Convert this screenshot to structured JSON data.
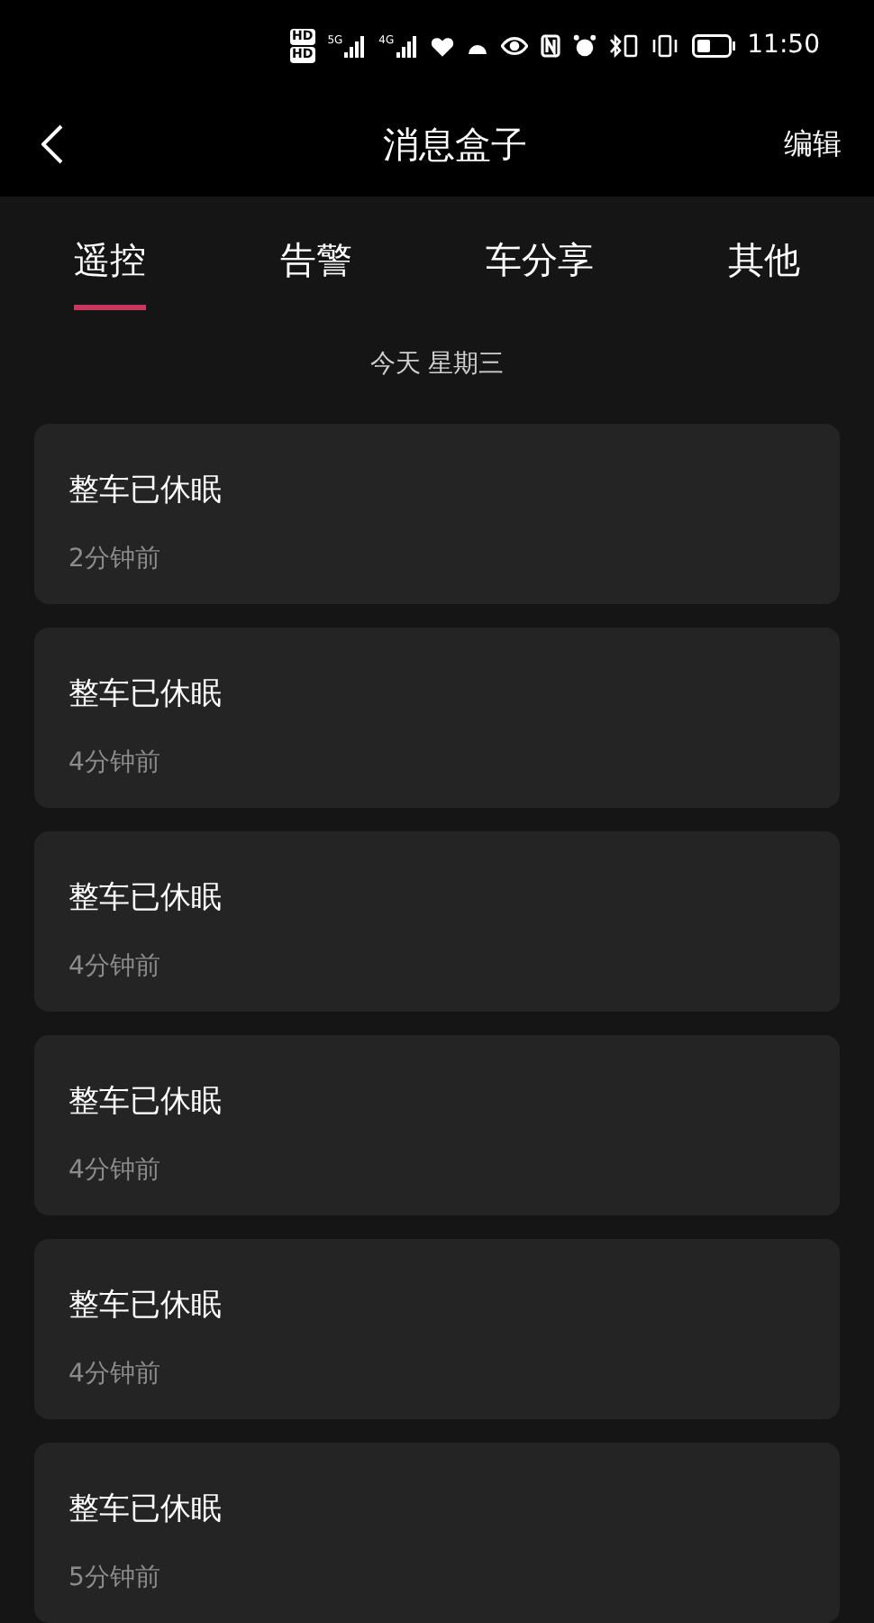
{
  "status_bar": {
    "sim_badges": [
      "HD",
      "HD"
    ],
    "networks": [
      "5G",
      "4G"
    ],
    "time": "11:50"
  },
  "header": {
    "title": "消息盒子",
    "action": "编辑"
  },
  "tabs": [
    {
      "label": "遥控",
      "selected": true
    },
    {
      "label": "告警",
      "selected": false
    },
    {
      "label": "车分享",
      "selected": false
    },
    {
      "label": "其他",
      "selected": false
    }
  ],
  "date": "今天 星期三",
  "messages": [
    {
      "title": "整车已休眠",
      "time": "2分钟前"
    },
    {
      "title": "整车已休眠",
      "time": "4分钟前"
    },
    {
      "title": "整车已休眠",
      "time": "4分钟前"
    },
    {
      "title": "整车已休眠",
      "time": "4分钟前"
    },
    {
      "title": "整车已休眠",
      "time": "4分钟前"
    },
    {
      "title": "整车已休眠",
      "time": "5分钟前"
    }
  ]
}
